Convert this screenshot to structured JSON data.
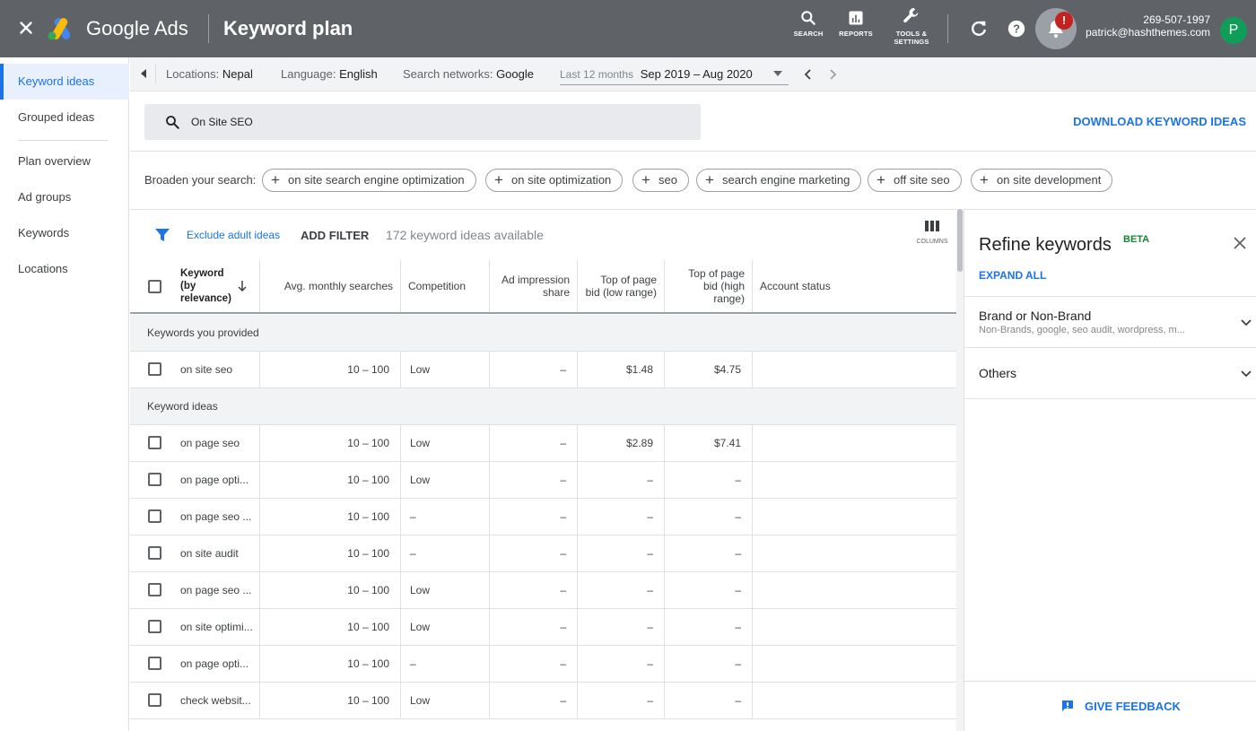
{
  "topbar": {
    "brand": "Google Ads",
    "title": "Keyword plan",
    "tools": [
      {
        "label": "SEARCH",
        "icon": "search-icon"
      },
      {
        "label": "REPORTS",
        "icon": "reports-icon"
      },
      {
        "label_line1": "TOOLS &",
        "label_line2": "SETTINGS",
        "icon": "wrench-icon"
      }
    ],
    "notification_badge": "!",
    "account_id": "269-507-1997",
    "account_email": "patrick@hashthemes.com",
    "avatar_letter": "P"
  },
  "sidebar": {
    "items": [
      {
        "label": "Keyword ideas",
        "active": true
      },
      {
        "label": "Grouped ideas"
      },
      {
        "label": "Plan overview"
      },
      {
        "label": "Ad groups"
      },
      {
        "label": "Keywords"
      },
      {
        "label": "Locations"
      }
    ]
  },
  "filters": {
    "locations_label": "Locations:",
    "locations_value": "Nepal",
    "language_label": "Language:",
    "language_value": "English",
    "networks_label": "Search networks:",
    "networks_value": "Google",
    "range_label": "Last 12 months",
    "range_value": "Sep 2019 – Aug 2020"
  },
  "search": {
    "query": "On Site SEO",
    "download_label": "DOWNLOAD KEYWORD IDEAS"
  },
  "broaden": {
    "label": "Broaden your search:",
    "chips": [
      "on site search engine optimization",
      "on site optimization",
      "seo",
      "search engine marketing",
      "off site seo",
      "on site development"
    ]
  },
  "table_toolbar": {
    "exclude_adult": "Exclude adult ideas",
    "add_filter": "ADD FILTER",
    "available": "172 keyword ideas available",
    "columns_label": "COLUMNS"
  },
  "table": {
    "headers": {
      "keyword_l1": "Keyword",
      "keyword_l2": "(by",
      "keyword_l3": "relevance)",
      "avg": "Avg. monthly searches",
      "competition": "Competition",
      "impression_l1": "Ad impression",
      "impression_l2": "share",
      "low_l1": "Top of page",
      "low_l2": "bid (low range)",
      "high_l1": "Top of page",
      "high_l2": "bid (high",
      "high_l3": "range)",
      "status": "Account status"
    },
    "section_provided": "Keywords you provided",
    "section_ideas": "Keyword ideas",
    "provided": [
      {
        "keyword": "on site seo",
        "avg": "10 – 100",
        "competition": "Low",
        "impression": "–",
        "low": "$1.48",
        "high": "$4.75"
      }
    ],
    "ideas": [
      {
        "keyword": "on page seo",
        "avg": "10 – 100",
        "competition": "Low",
        "impression": "–",
        "low": "$2.89",
        "high": "$7.41"
      },
      {
        "keyword": "on page opti...",
        "avg": "10 – 100",
        "competition": "Low",
        "impression": "–",
        "low": "–",
        "high": "–"
      },
      {
        "keyword": "on page seo ...",
        "avg": "10 – 100",
        "competition": "–",
        "impression": "–",
        "low": "–",
        "high": "–"
      },
      {
        "keyword": "on site audit",
        "avg": "10 – 100",
        "competition": "–",
        "impression": "–",
        "low": "–",
        "high": "–"
      },
      {
        "keyword": "on page seo ...",
        "avg": "10 – 100",
        "competition": "Low",
        "impression": "–",
        "low": "–",
        "high": "–"
      },
      {
        "keyword": "on site optimi...",
        "avg": "10 – 100",
        "competition": "Low",
        "impression": "–",
        "low": "–",
        "high": "–"
      },
      {
        "keyword": "on page opti...",
        "avg": "10 – 100",
        "competition": "–",
        "impression": "–",
        "low": "–",
        "high": "–"
      },
      {
        "keyword": "check websit...",
        "avg": "10 – 100",
        "competition": "Low",
        "impression": "–",
        "low": "–",
        "high": "–"
      }
    ]
  },
  "refine": {
    "title": "Refine keywords",
    "beta": "BETA",
    "expand_all": "EXPAND ALL",
    "sections": [
      {
        "title": "Brand or Non-Brand",
        "subtitle": "Non-Brands, google, seo audit, wordpress, m..."
      },
      {
        "title": "Others"
      }
    ],
    "feedback": "GIVE FEEDBACK"
  },
  "colors": {
    "topbar": "#5f6368",
    "accent": "#1a73e8",
    "beta": "#188038",
    "badge": "#c5221f",
    "avatar": "#0f9d58"
  }
}
